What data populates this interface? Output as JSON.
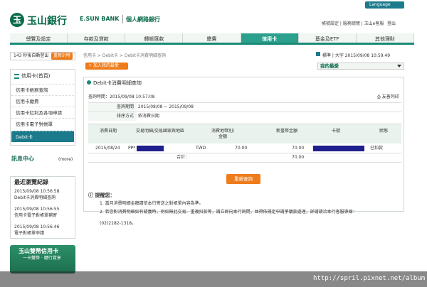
{
  "header": {
    "language_label": "Language",
    "logo_mark": "玉",
    "logo_text": "玉山銀行",
    "logo_en": "E.SUN BANK",
    "logo_sub": "個人網路銀行",
    "top_links": "帳號設定 | 服務總覽 | 玉山e客服",
    "logout_label": "登出"
  },
  "nav": {
    "items": [
      "總覽及設定",
      "存款及貸款",
      "轉帳匯款",
      "繳費",
      "信用卡",
      "基金及ETF",
      "其他理財"
    ],
    "active_index": 4
  },
  "sidebar": {
    "timer_text": "143 秒後自動登出",
    "timer_button": "重新計時",
    "menu_header": "信用卡(首頁)",
    "items": [
      "信用卡帳務查詢",
      "信用卡繳費",
      "信用卡紅利及各項申請",
      "信用卡電子對帳單",
      "Debit卡"
    ],
    "active_index": 4,
    "message_center": "訊息中心",
    "more_label": "(more)",
    "recent_title": "最近瀏覽紀錄",
    "recent": [
      {
        "time": "2015/09/08 10:56:58",
        "page": "Debit卡消費明細查詢"
      },
      {
        "time": "2015/09/08 10:56:55",
        "page": "信用卡電子對帳單補寄"
      },
      {
        "time": "2015/09/08 10:56:46",
        "page": "電子對帳單申請"
      }
    ],
    "promo_title": "玉山雙幣信用卡",
    "promo_sub": "一卡雙幣 · 鍵行賞享"
  },
  "main": {
    "breadcrumb": "信用卡 > Debit卡 > Debit卡消費明細查詢",
    "tools": "標準 | 大字  2015/09/08 10:59.49",
    "add_favorite": "+ 加入我的最愛",
    "favorite_select": "我的最愛",
    "panel_title": "Debit卡消費明細查詢",
    "query_time": "查詢時間：2015/09/08 10:57:08",
    "print_label": "友善列印",
    "period_label": "查詢期間",
    "period_value": "2015/08/08 ~ 2015/09/08",
    "sort_label": "排序方式",
    "sort_value": "依消費日期",
    "table": {
      "headers": [
        "消費日期",
        "交易明細/交易國家與地區",
        "消費地幣別/金額",
        "新臺幣金額",
        "卡號",
        "狀態"
      ],
      "row": {
        "date": "2015/08/24",
        "detail_prefix": "PP*",
        "currency": "TWD",
        "amount": "70.00",
        "twd_amount": "70.00",
        "status": "已扣款"
      },
      "total_label": "合計：",
      "total_value": "70.00"
    },
    "requery_button": "重新查詢",
    "notice_title": "提醒您：",
    "notices": [
      "1. 當月消費明細金額請依本行寄送之對帳單內容為準。",
      "2. 若您對消費明細如有疑義時，例如無此交易、重複扣款等，請立即向本行詢問，並得依規定申請爭議款處理，詳請請洽本行客服專線：",
      "(02)2182-1318。"
    ]
  },
  "watermark": "http://spril.pixnet.net/album"
}
